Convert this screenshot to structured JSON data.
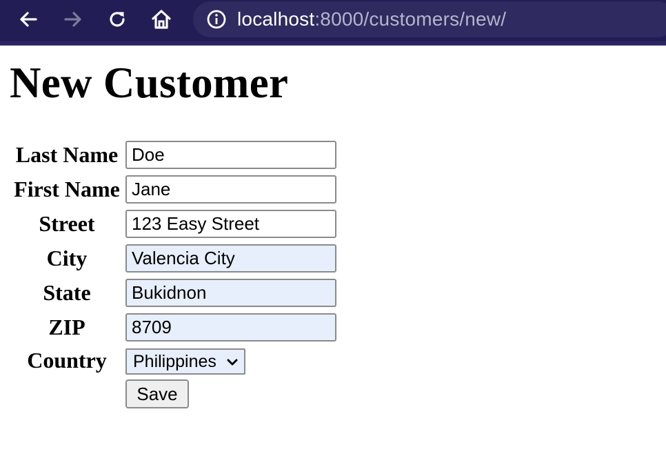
{
  "browser": {
    "url_host": "localhost",
    "url_path": ":8000/customers/new/",
    "icons": [
      "back-arrow-icon",
      "forward-arrow-icon",
      "reload-icon",
      "home-icon",
      "info-icon"
    ]
  },
  "page": {
    "title": "New Customer"
  },
  "form": {
    "fields": {
      "last_name": {
        "label": "Last Name",
        "value": "Doe"
      },
      "first_name": {
        "label": "First Name",
        "value": "Jane"
      },
      "street": {
        "label": "Street",
        "value": "123 Easy Street"
      },
      "city": {
        "label": "City",
        "value": "Valencia City"
      },
      "state": {
        "label": "State",
        "value": "Bukidnon"
      },
      "zip": {
        "label": "ZIP",
        "value": "8709"
      }
    },
    "country": {
      "label": "Country",
      "selected": "Philippines"
    },
    "save_label": "Save"
  },
  "colors": {
    "toolbar_bg": "#221e55",
    "urlbar_bg": "#2f2b60",
    "autofill_bg": "#e8effc"
  }
}
